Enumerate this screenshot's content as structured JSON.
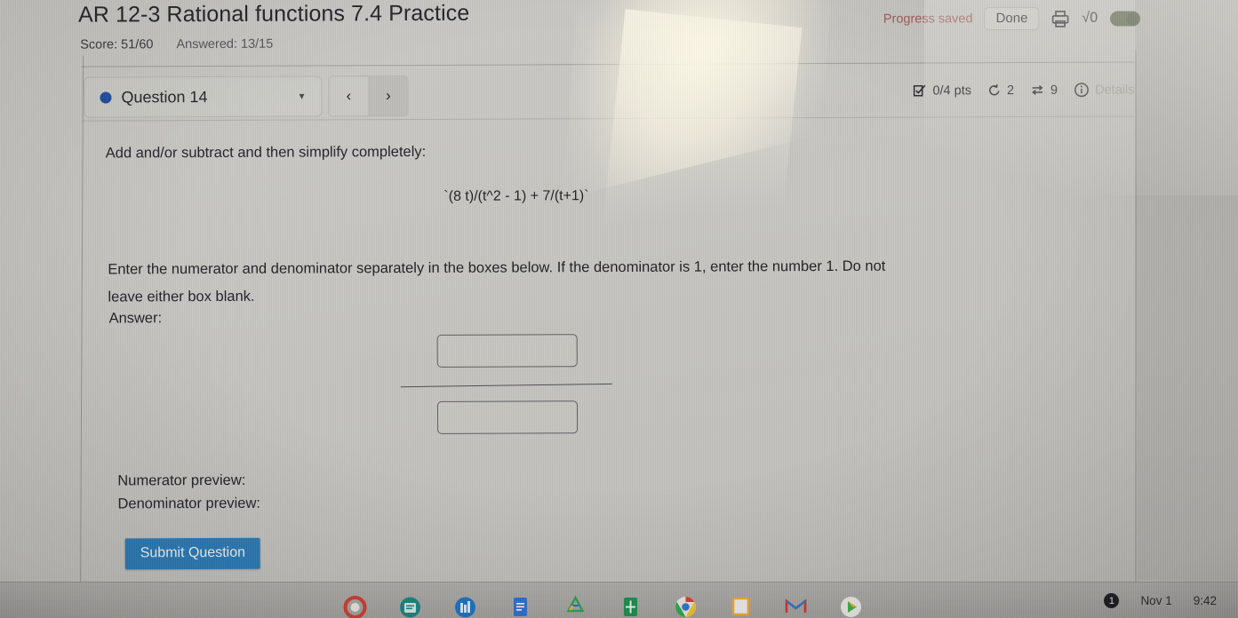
{
  "header": {
    "title": "AR 12-3 Rational functions 7.4 Practice",
    "score_label": "Score: 51/60",
    "answered_label": "Answered: 13/15",
    "progress_saved": "Progress saved",
    "done_label": "Done",
    "print_icon": "printer-icon",
    "sqrt_label": "√0",
    "equation_toggle": "on"
  },
  "question_bar": {
    "question_label": "Question 14",
    "status_dot_color": "#1f4ea1",
    "caret_icon": "chevron-down-icon",
    "prev_label": "‹",
    "next_label": "›",
    "points": "0/4 pts",
    "attempts_icon": "undo-icon",
    "attempts": "2",
    "retry_icon": "shuffle-icon",
    "retries": "9",
    "info_icon": "info-icon",
    "details_label": "Details"
  },
  "question": {
    "prompt": "Add and/or subtract and then simplify completely:",
    "formula": "`(8 t)/(t^2 - 1) + 7/(t+1)`",
    "instructions": "Enter the numerator and denominator separately in the boxes below. If the denominator is 1, enter the number 1. Do not leave either box blank.",
    "answer_label": "Answer:",
    "numerator_value": "",
    "numerator_placeholder": "",
    "denominator_value": "",
    "denominator_placeholder": "",
    "numerator_preview_label": "Numerator preview:",
    "numerator_preview_value": "",
    "denominator_preview_label": "Denominator preview:",
    "denominator_preview_value": "",
    "submit_label": "Submit Question",
    "submit_color": "#2a7ab5"
  },
  "taskbar": {
    "notification_badge": "1",
    "date": "Nov 1",
    "time": "9:42",
    "icons": [
      "chrome-red-icon",
      "teal-app-icon",
      "blue-app-icon",
      "docs-icon",
      "drive-icon",
      "sheets-icon",
      "chrome-icon",
      "calendar-icon",
      "gmail-icon",
      "play-store-icon"
    ]
  }
}
